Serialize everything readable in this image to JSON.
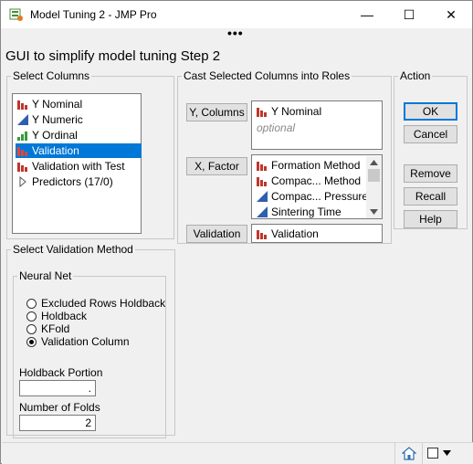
{
  "window": {
    "title": "Model Tuning 2 - JMP Pro",
    "minimize": "—",
    "maximize": "☐",
    "close": "✕",
    "menu_dots": "•••"
  },
  "heading": "GUI to simplify model tuning Step 2",
  "select_columns": {
    "legend": "Select Columns",
    "items": [
      {
        "label": "Y Nominal",
        "icon": "nominal-icon"
      },
      {
        "label": "Y Numeric",
        "icon": "continuous-icon"
      },
      {
        "label": "Y Ordinal",
        "icon": "ordinal-icon"
      },
      {
        "label": "Validation",
        "icon": "nominal-icon",
        "selected": true
      },
      {
        "label": "Validation with Test",
        "icon": "nominal-icon"
      },
      {
        "label": "Predictors (17/0)",
        "icon": "disclosure-triangle-icon"
      }
    ]
  },
  "cast_roles": {
    "legend": "Cast Selected Columns into Roles",
    "y_columns": {
      "button": "Y, Columns",
      "items": [
        "Y Nominal"
      ],
      "placeholder": "optional"
    },
    "x_factor": {
      "button": "X, Factor",
      "items": [
        "Formation Method",
        "Compac... Method",
        "Compac... Pressure",
        "Sintering Time"
      ]
    },
    "validation": {
      "button": "Validation",
      "items": [
        "Validation"
      ]
    }
  },
  "action": {
    "legend": "Action",
    "ok": "OK",
    "cancel": "Cancel",
    "remove": "Remove",
    "recall": "Recall",
    "help": "Help"
  },
  "validation_method": {
    "legend": "Select Validation Method",
    "neural_net": {
      "legend": "Neural Net",
      "options": [
        "Excluded Rows Holdback",
        "Holdback",
        "KFold",
        "Validation Column"
      ],
      "selected": "Validation Column"
    },
    "holdback_portion": {
      "label": "Holdback Portion",
      "value": "."
    },
    "number_of_folds": {
      "label": "Number of Folds",
      "value": "2"
    }
  },
  "status": {
    "home_icon": "home-icon",
    "box_icon": "checkbox-icon",
    "dropdown_icon": "dropdown-arrow-icon"
  }
}
